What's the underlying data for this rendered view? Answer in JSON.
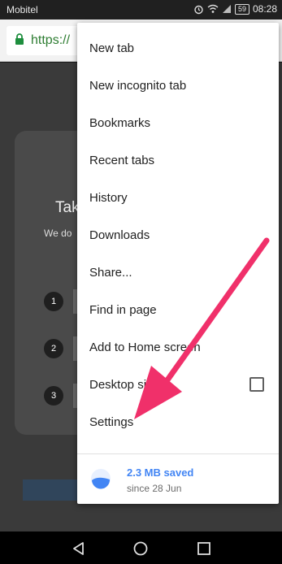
{
  "status_bar": {
    "carrier": "Mobitel",
    "battery": "59",
    "time": "08:28",
    "icons": [
      "alarm-icon",
      "wifi-icon",
      "signal-icon",
      "battery-icon"
    ]
  },
  "url_bar": {
    "url": "https://",
    "lock_icon": "lock-icon",
    "lock_color": "#1e8e3e"
  },
  "page": {
    "title_fragment": "Tak",
    "subtitle_fragment": "We do",
    "steps": [
      "1",
      "2",
      "3"
    ]
  },
  "menu": {
    "items": [
      {
        "label": "New tab"
      },
      {
        "label": "New incognito tab"
      },
      {
        "label": "Bookmarks"
      },
      {
        "label": "Recent tabs"
      },
      {
        "label": "History"
      },
      {
        "label": "Downloads"
      },
      {
        "label": "Share..."
      },
      {
        "label": "Find in page"
      },
      {
        "label": "Add to Home screen"
      },
      {
        "label": "Desktop site"
      },
      {
        "label": "Settings"
      }
    ],
    "desktop_site_checked": false,
    "data_saver": {
      "amount": "2.3 MB saved",
      "since": "since 28 Jun",
      "accent": "#4285f4"
    }
  },
  "annotation": {
    "arrow_color": "#f0306a"
  },
  "nav_bar": {
    "buttons": [
      "back-icon",
      "home-icon",
      "recents-icon"
    ]
  }
}
